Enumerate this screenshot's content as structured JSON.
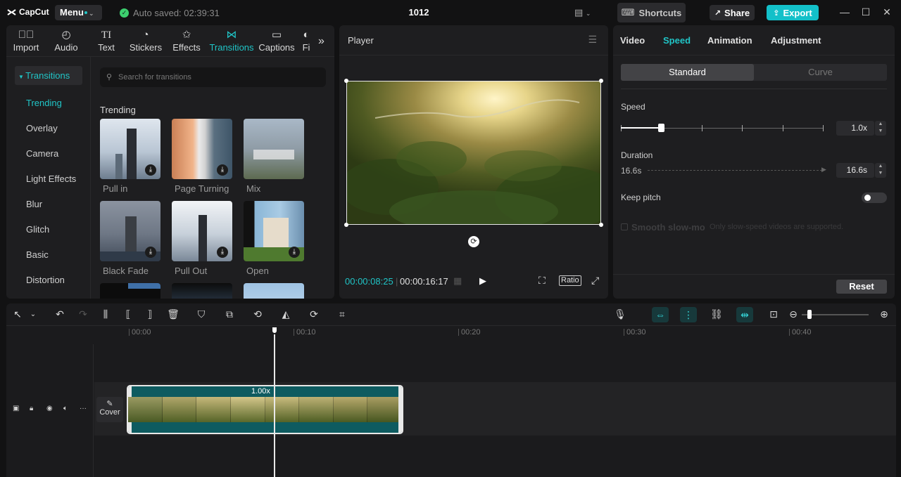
{
  "app": {
    "logo": "CapCut",
    "menu": "Menu",
    "autosave": "Auto saved: 02:39:31",
    "project_title": "1012",
    "shortcuts": "Shortcuts",
    "share": "Share",
    "export": "Export"
  },
  "media_tabs": [
    {
      "label": "Import",
      "icon": "import-icon"
    },
    {
      "label": "Audio",
      "icon": "audio-icon"
    },
    {
      "label": "Text",
      "icon": "text-icon"
    },
    {
      "label": "Stickers",
      "icon": "stickers-icon"
    },
    {
      "label": "Effects",
      "icon": "effects-icon"
    },
    {
      "label": "Transitions",
      "icon": "transitions-icon",
      "active": true
    },
    {
      "label": "Captions",
      "icon": "captions-icon"
    },
    {
      "label": "Fi",
      "icon": "filters-icon"
    }
  ],
  "sidebar": {
    "header": "Transitions",
    "items": [
      "Trending",
      "Overlay",
      "Camera",
      "Light Effects",
      "Blur",
      "Glitch",
      "Basic",
      "Distortion"
    ],
    "active": "Trending"
  },
  "search": {
    "placeholder": "Search for transitions"
  },
  "section_title": "Trending",
  "transitions": [
    {
      "label": "Pull in"
    },
    {
      "label": "Page Turning"
    },
    {
      "label": "Mix"
    },
    {
      "label": "Black Fade"
    },
    {
      "label": "Pull Out"
    },
    {
      "label": "Open"
    }
  ],
  "player": {
    "title": "Player",
    "current_time": "00:00:08:25",
    "total_time": "00:00:16:17",
    "ratio": "Ratio"
  },
  "inspector": {
    "tabs": [
      "Video",
      "Speed",
      "Animation",
      "Adjustment"
    ],
    "active_tab": "Speed",
    "modes": [
      "Standard",
      "Curve"
    ],
    "speed_label": "Speed",
    "speed_value": "1.0x",
    "duration_label": "Duration",
    "duration_original": "16.6s",
    "duration_value": "16.6s",
    "keep_pitch": "Keep pitch",
    "smooth_label": "Smooth slow-mo",
    "smooth_note": "Only slow-speed videos are supported.",
    "reset": "Reset"
  },
  "timeline": {
    "ruler": [
      "00:00",
      "00:10",
      "00:20",
      "00:30",
      "00:40"
    ],
    "cover": "Cover",
    "clip_speed": "1.00x"
  },
  "colors": {
    "accent": "#20c5c7",
    "export_bg": "#13c0c9",
    "clip_bg": "#0e5b60"
  }
}
